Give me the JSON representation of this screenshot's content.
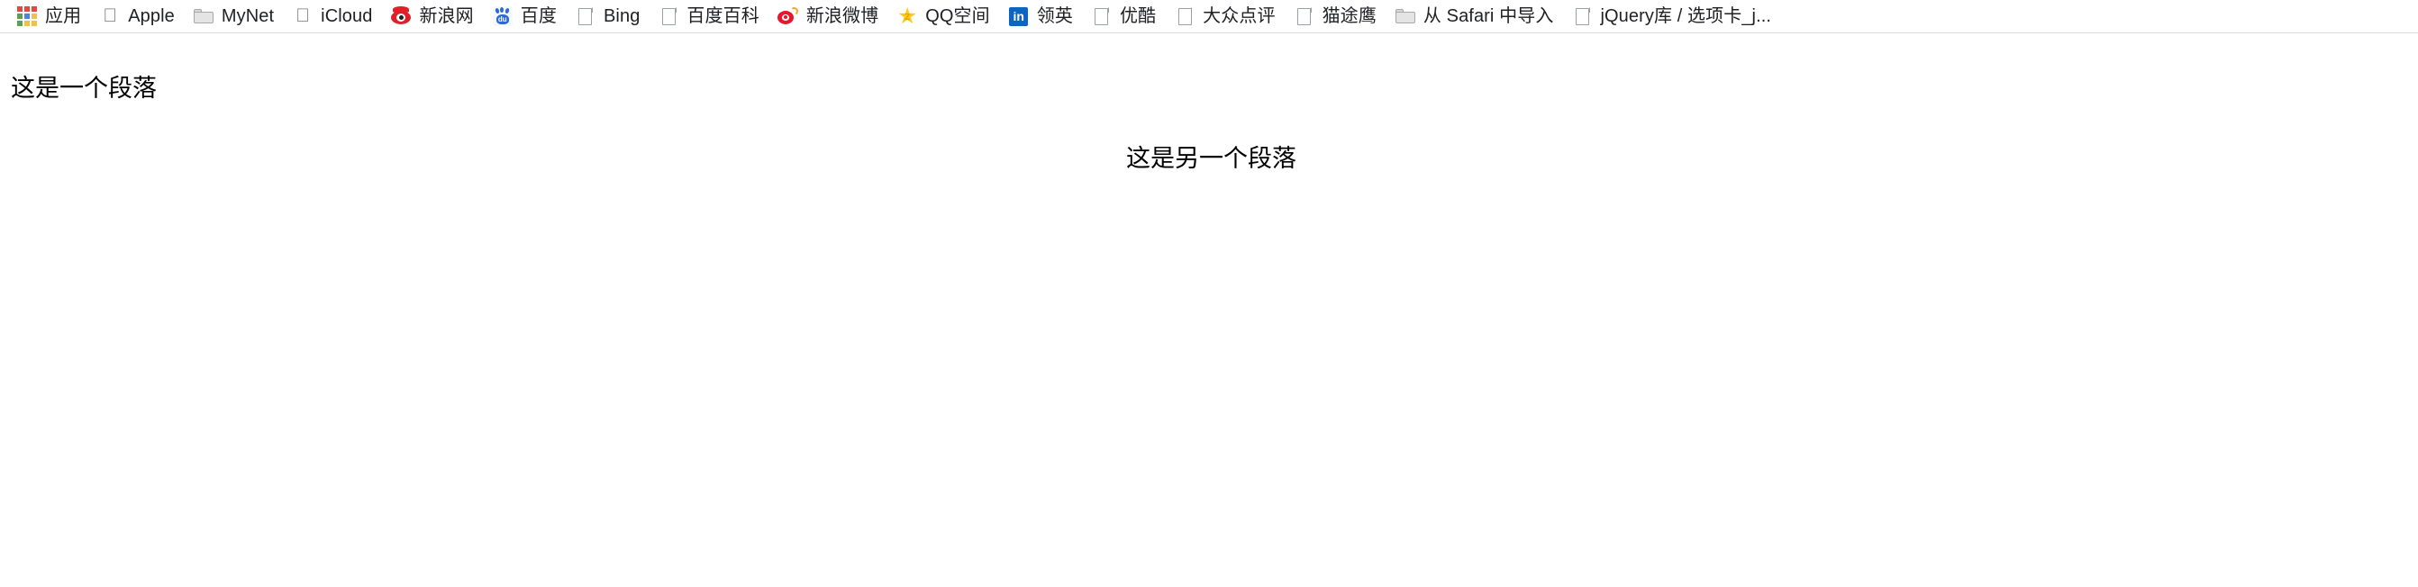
{
  "browser": {
    "bookmarks_bar": {
      "items": [
        {
          "label": "应用",
          "icon": "apps-grid-icon"
        },
        {
          "label": "Apple",
          "icon": "apple-icon"
        },
        {
          "label": "MyNet",
          "icon": "folder-icon"
        },
        {
          "label": "iCloud",
          "icon": "apple-icon"
        },
        {
          "label": "新浪网",
          "icon": "sina-eye-icon"
        },
        {
          "label": "百度",
          "icon": "baidu-paw-icon"
        },
        {
          "label": "Bing",
          "icon": "page-icon"
        },
        {
          "label": "百度百科",
          "icon": "page-icon"
        },
        {
          "label": "新浪微博",
          "icon": "weibo-icon"
        },
        {
          "label": "QQ空间",
          "icon": "star-icon"
        },
        {
          "label": "领英",
          "icon": "linkedin-icon"
        },
        {
          "label": "优酷",
          "icon": "page-icon"
        },
        {
          "label": "大众点评",
          "icon": "page-icon"
        },
        {
          "label": "猫途鹰",
          "icon": "page-icon"
        },
        {
          "label": "从 Safari 中导入",
          "icon": "folder-icon"
        },
        {
          "label": "jQuery库 / 选项卡_j...",
          "icon": "page-icon"
        }
      ]
    }
  },
  "page": {
    "paragraph_1": "这是一个段落",
    "paragraph_2": "这是另一个段落"
  },
  "colors": {
    "bar_background": "#ffffff",
    "bar_border": "#dcdcdc",
    "text": "#202124",
    "page_text": "#000000",
    "sina_red": "#e01f28",
    "baidu_blue": "#2d68d8",
    "weibo_red": "#e6162d",
    "qq_yellow": "#ffc918",
    "linkedin_blue": "#0a66c2",
    "icon_gray": "#9aa0a6"
  }
}
